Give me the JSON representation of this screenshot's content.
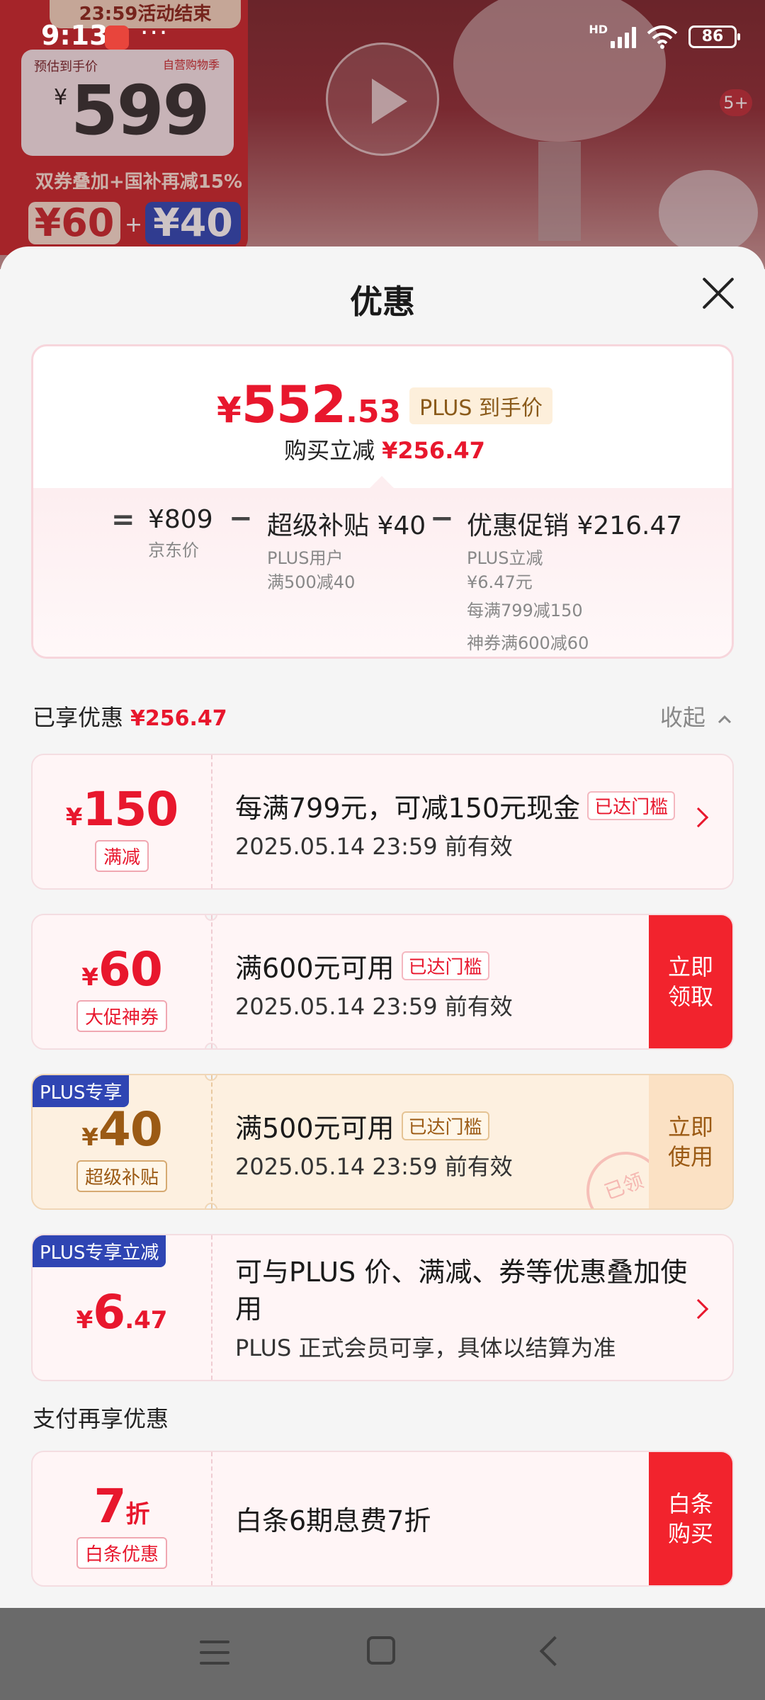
{
  "status_bar": {
    "time": "9:13",
    "network": "HD",
    "battery": "86"
  },
  "background": {
    "promo_ribbon": "23:59活动结束",
    "promo_est_label": "预估到手价",
    "promo_brand": "自营购物季",
    "promo_currency": "¥",
    "promo_price": "599",
    "promo_sub": "双券叠加+国补再减15%",
    "promo_coupon_1": "¥60",
    "promo_coupon_2": "¥40",
    "media_count": "5+"
  },
  "sheet": {
    "title": "优惠",
    "summary": {
      "price_yen": "¥",
      "price_int": "552",
      "price_dec": ".53",
      "plus_tag": "PLUS 到手价",
      "reduce_label": "购买立减",
      "reduce_amount": "¥256.47",
      "breakdown": {
        "eq": "=",
        "minus": "−",
        "jd_price": "¥809",
        "jd_price_label": "京东价",
        "subsidy_main": "超级补贴 ¥40",
        "subsidy_sub1": "PLUS用户",
        "subsidy_sub2": "满500减40",
        "promo_main": "优惠促销 ¥216.47",
        "promo_sub1": "PLUS立减",
        "promo_sub2": "¥6.47元",
        "promo_sub3": "每满799减150",
        "promo_sub4": "神券满600减60"
      }
    },
    "saved_label": "已享优惠",
    "saved_amount": "¥256.47",
    "collapse_label": "收起",
    "coupons": [
      {
        "yen": "¥",
        "amount": "150",
        "tag": "满减",
        "title": "每满799元，可减150元现金",
        "reach": "已达门槛",
        "expire": "2025.05.14 23:59 前有效"
      },
      {
        "yen": "¥",
        "amount": "60",
        "tag": "大促神券",
        "title": "满600元可用",
        "reach": "已达门槛",
        "expire": "2025.05.14 23:59 前有效",
        "action": "立即\n领取"
      },
      {
        "corner": "PLUS专享",
        "yen": "¥",
        "amount": "40",
        "tag": "超级补贴",
        "title": "满500元可用",
        "reach": "已达门槛",
        "expire": "2025.05.14 23:59 前有效",
        "action": "立即\n使用",
        "stamp": "已领"
      },
      {
        "corner": "PLUS专享立减",
        "yen": "¥",
        "amount": "6",
        "amount_dec": ".47",
        "desc1": "可与PLUS 价、满减、券等优惠叠加使用",
        "desc2": "PLUS 正式会员可享，具体以结算为准"
      }
    ],
    "pay_header": "支付再享优惠",
    "pay_offer": {
      "amount": "7",
      "unit": "折",
      "tag": "白条优惠",
      "title": "白条6期息费7折",
      "action": "白条\n购买"
    }
  },
  "colors": {
    "accent_red": "#e8172d",
    "plus_blue": "#2f45b3",
    "gold": "#9b5a14"
  }
}
